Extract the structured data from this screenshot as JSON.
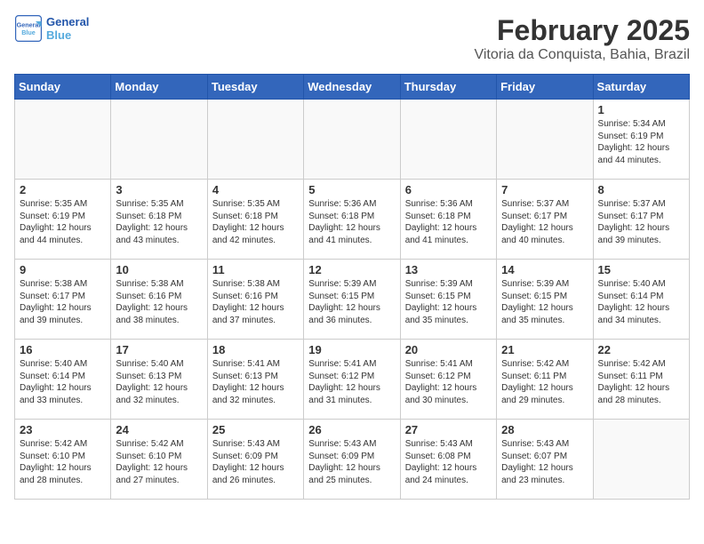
{
  "header": {
    "logo_general": "General",
    "logo_blue": "Blue",
    "title": "February 2025",
    "subtitle": "Vitoria da Conquista, Bahia, Brazil"
  },
  "days_of_week": [
    "Sunday",
    "Monday",
    "Tuesday",
    "Wednesday",
    "Thursday",
    "Friday",
    "Saturday"
  ],
  "weeks": [
    [
      {
        "day": "",
        "info": ""
      },
      {
        "day": "",
        "info": ""
      },
      {
        "day": "",
        "info": ""
      },
      {
        "day": "",
        "info": ""
      },
      {
        "day": "",
        "info": ""
      },
      {
        "day": "",
        "info": ""
      },
      {
        "day": "1",
        "info": "Sunrise: 5:34 AM\nSunset: 6:19 PM\nDaylight: 12 hours and 44 minutes."
      }
    ],
    [
      {
        "day": "2",
        "info": "Sunrise: 5:35 AM\nSunset: 6:19 PM\nDaylight: 12 hours and 44 minutes."
      },
      {
        "day": "3",
        "info": "Sunrise: 5:35 AM\nSunset: 6:18 PM\nDaylight: 12 hours and 43 minutes."
      },
      {
        "day": "4",
        "info": "Sunrise: 5:35 AM\nSunset: 6:18 PM\nDaylight: 12 hours and 42 minutes."
      },
      {
        "day": "5",
        "info": "Sunrise: 5:36 AM\nSunset: 6:18 PM\nDaylight: 12 hours and 41 minutes."
      },
      {
        "day": "6",
        "info": "Sunrise: 5:36 AM\nSunset: 6:18 PM\nDaylight: 12 hours and 41 minutes."
      },
      {
        "day": "7",
        "info": "Sunrise: 5:37 AM\nSunset: 6:17 PM\nDaylight: 12 hours and 40 minutes."
      },
      {
        "day": "8",
        "info": "Sunrise: 5:37 AM\nSunset: 6:17 PM\nDaylight: 12 hours and 39 minutes."
      }
    ],
    [
      {
        "day": "9",
        "info": "Sunrise: 5:38 AM\nSunset: 6:17 PM\nDaylight: 12 hours and 39 minutes."
      },
      {
        "day": "10",
        "info": "Sunrise: 5:38 AM\nSunset: 6:16 PM\nDaylight: 12 hours and 38 minutes."
      },
      {
        "day": "11",
        "info": "Sunrise: 5:38 AM\nSunset: 6:16 PM\nDaylight: 12 hours and 37 minutes."
      },
      {
        "day": "12",
        "info": "Sunrise: 5:39 AM\nSunset: 6:15 PM\nDaylight: 12 hours and 36 minutes."
      },
      {
        "day": "13",
        "info": "Sunrise: 5:39 AM\nSunset: 6:15 PM\nDaylight: 12 hours and 35 minutes."
      },
      {
        "day": "14",
        "info": "Sunrise: 5:39 AM\nSunset: 6:15 PM\nDaylight: 12 hours and 35 minutes."
      },
      {
        "day": "15",
        "info": "Sunrise: 5:40 AM\nSunset: 6:14 PM\nDaylight: 12 hours and 34 minutes."
      }
    ],
    [
      {
        "day": "16",
        "info": "Sunrise: 5:40 AM\nSunset: 6:14 PM\nDaylight: 12 hours and 33 minutes."
      },
      {
        "day": "17",
        "info": "Sunrise: 5:40 AM\nSunset: 6:13 PM\nDaylight: 12 hours and 32 minutes."
      },
      {
        "day": "18",
        "info": "Sunrise: 5:41 AM\nSunset: 6:13 PM\nDaylight: 12 hours and 32 minutes."
      },
      {
        "day": "19",
        "info": "Sunrise: 5:41 AM\nSunset: 6:12 PM\nDaylight: 12 hours and 31 minutes."
      },
      {
        "day": "20",
        "info": "Sunrise: 5:41 AM\nSunset: 6:12 PM\nDaylight: 12 hours and 30 minutes."
      },
      {
        "day": "21",
        "info": "Sunrise: 5:42 AM\nSunset: 6:11 PM\nDaylight: 12 hours and 29 minutes."
      },
      {
        "day": "22",
        "info": "Sunrise: 5:42 AM\nSunset: 6:11 PM\nDaylight: 12 hours and 28 minutes."
      }
    ],
    [
      {
        "day": "23",
        "info": "Sunrise: 5:42 AM\nSunset: 6:10 PM\nDaylight: 12 hours and 28 minutes."
      },
      {
        "day": "24",
        "info": "Sunrise: 5:42 AM\nSunset: 6:10 PM\nDaylight: 12 hours and 27 minutes."
      },
      {
        "day": "25",
        "info": "Sunrise: 5:43 AM\nSunset: 6:09 PM\nDaylight: 12 hours and 26 minutes."
      },
      {
        "day": "26",
        "info": "Sunrise: 5:43 AM\nSunset: 6:09 PM\nDaylight: 12 hours and 25 minutes."
      },
      {
        "day": "27",
        "info": "Sunrise: 5:43 AM\nSunset: 6:08 PM\nDaylight: 12 hours and 24 minutes."
      },
      {
        "day": "28",
        "info": "Sunrise: 5:43 AM\nSunset: 6:07 PM\nDaylight: 12 hours and 23 minutes."
      },
      {
        "day": "",
        "info": ""
      }
    ]
  ]
}
